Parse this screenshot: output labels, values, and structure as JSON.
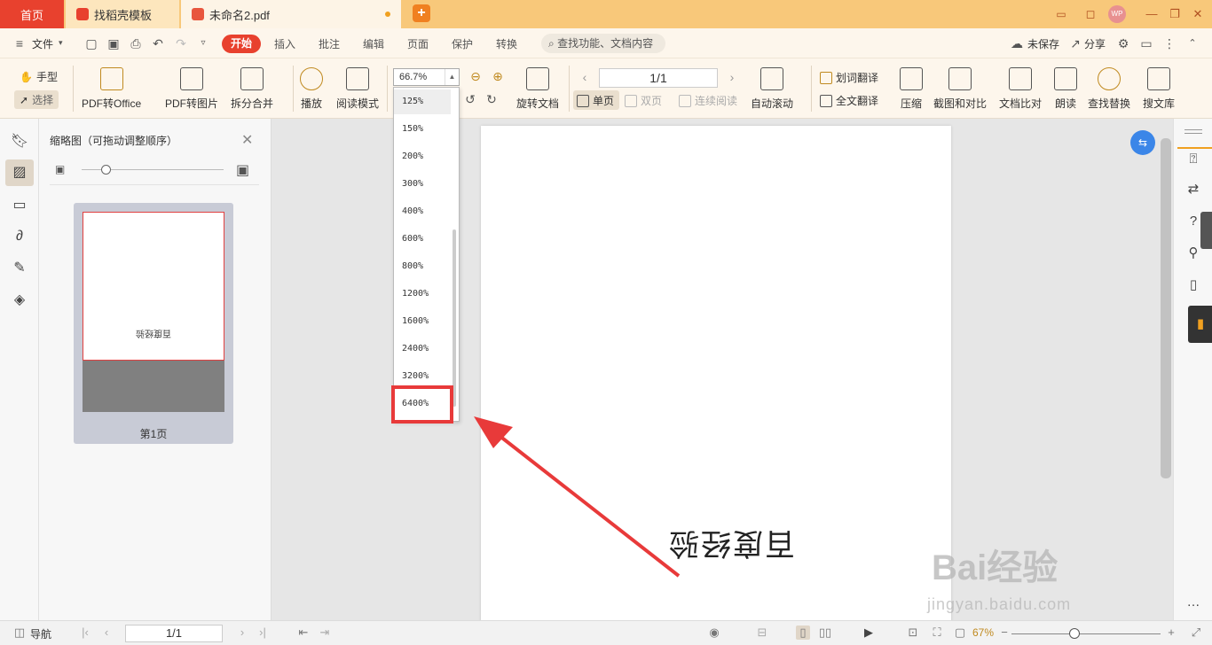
{
  "titlebar": {
    "tabs": [
      {
        "label": "首页"
      },
      {
        "label": "找稻壳模板"
      },
      {
        "label": "未命名2.pdf"
      }
    ],
    "avatar_text": "WP"
  },
  "menubar": {
    "file_label": "文件",
    "start_label": "开始",
    "items": [
      "插入",
      "批注",
      "编辑",
      "页面",
      "保护",
      "转换"
    ],
    "search_placeholder": "查找功能、文档内容",
    "unsaved_label": "未保存",
    "share_label": "分享"
  },
  "ribbon": {
    "hand_label": "手型",
    "select_label": "选择",
    "pdf_to_office": "PDF转Office",
    "pdf_to_image": "PDF转图片",
    "split_merge": "拆分合并",
    "play": "播放",
    "read_mode": "阅读模式",
    "zoom_value": "66.7%",
    "rotate_doc": "旋转文档",
    "page_value": "1/1",
    "single_page": "单页",
    "double_page": "双页",
    "continuous": "连续阅读",
    "auto_scroll": "自动滚动",
    "word_translate": "划词翻译",
    "full_translate": "全文翻译",
    "compress": "压缩",
    "screenshot_compare": "截图和对比",
    "doc_compare": "文档比对",
    "read_aloud": "朗读",
    "find_replace": "查找替换",
    "search_library": "搜文库"
  },
  "zoom_dropdown": {
    "options": [
      "125%",
      "150%",
      "200%",
      "300%",
      "400%",
      "600%",
      "800%",
      "1200%",
      "1600%",
      "2400%",
      "3200%",
      "6400%"
    ],
    "highlighted": "125%"
  },
  "thumbnail_panel": {
    "title": "缩略图（可拖动调整顺序）",
    "page_label": "第1页",
    "page_text": "百度经验"
  },
  "document": {
    "text": "百度经验"
  },
  "statusbar": {
    "nav_label": "导航",
    "page_value": "1/1",
    "zoom_value": "67%"
  },
  "watermark": {
    "brand": "Bai经验",
    "url": "jingyan.baidu.com"
  },
  "colors": {
    "title_bar": "#f8c87a",
    "accent": "#e8412e",
    "highlight_frame": "#e83a3a"
  }
}
